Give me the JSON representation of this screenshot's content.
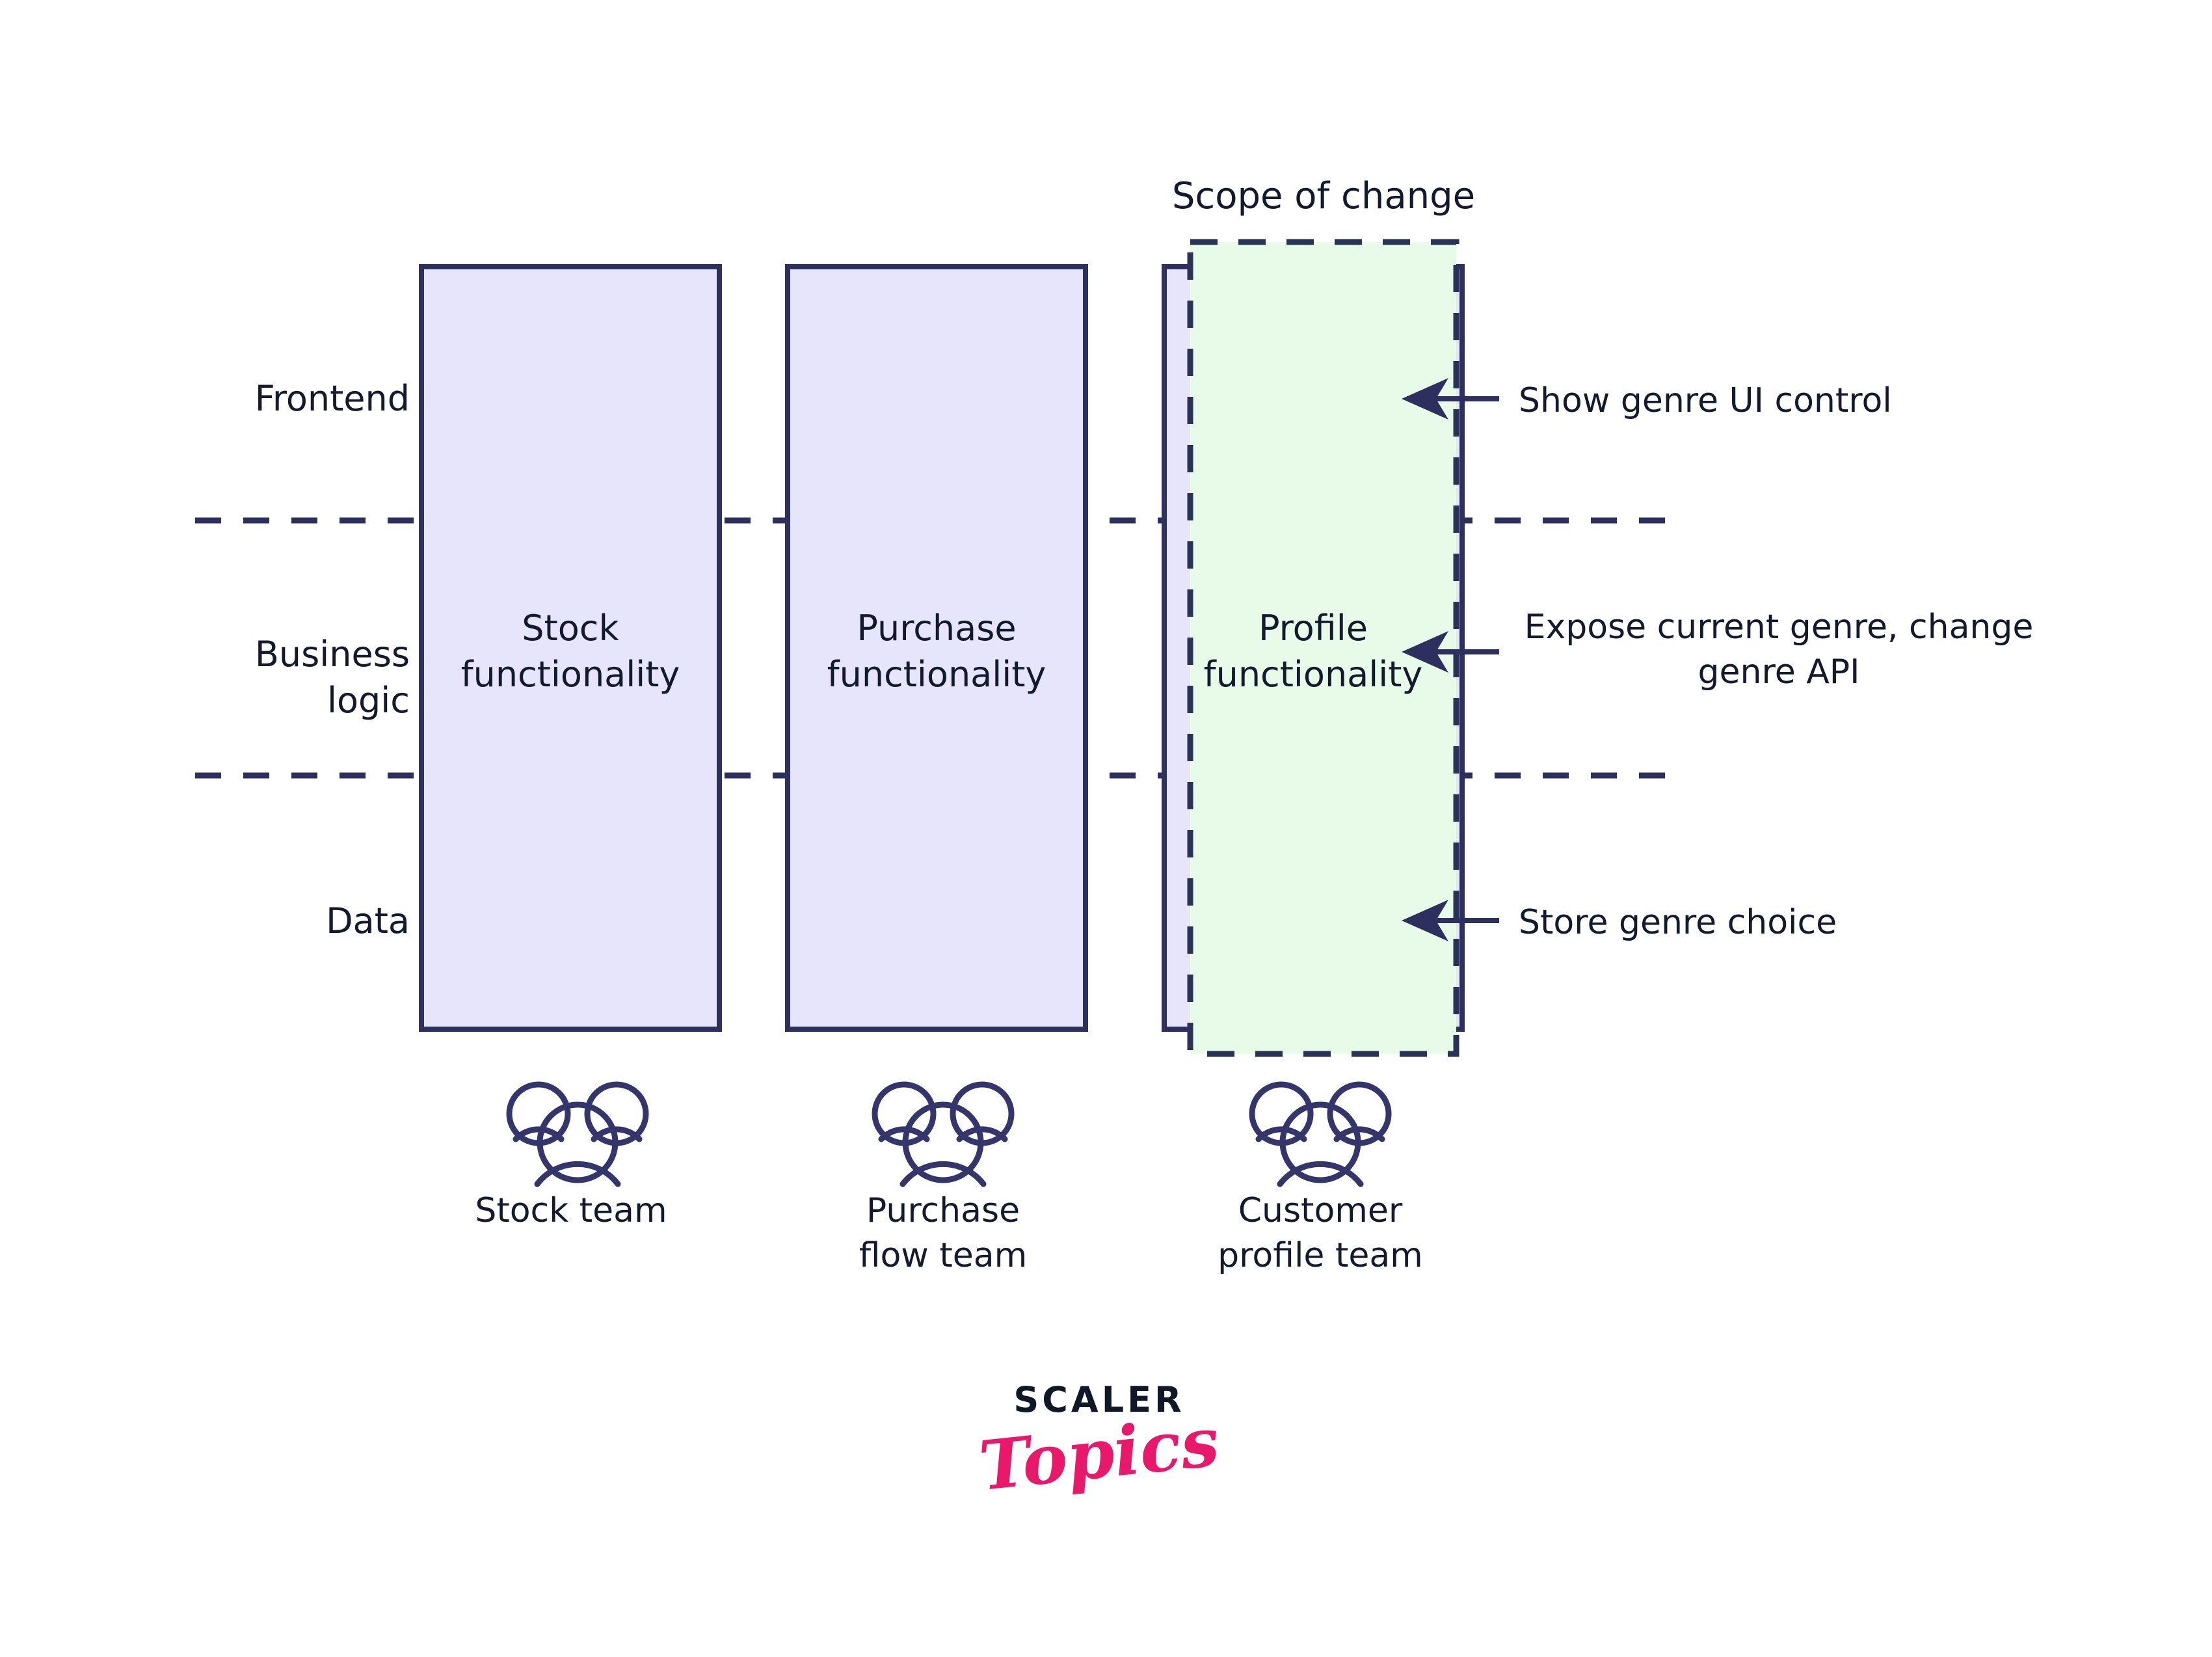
{
  "title": "Scope of change",
  "colors": {
    "stroke": "#2d2f5e",
    "text": "#141a2e",
    "box_fill": "#e6e5fb",
    "scope_fill": "#e8fbe9",
    "scope_stroke": "#2a3356",
    "logo_pink": "#e8186b",
    "logo_dark": "#101828",
    "background": "#ffffff"
  },
  "layer_labels": [
    {
      "id": "frontend",
      "text": "Frontend"
    },
    {
      "id": "business-logic",
      "text": "Business\nlogic"
    },
    {
      "id": "data",
      "text": "Data"
    }
  ],
  "columns": [
    {
      "id": "stock",
      "box_label": "Stock\nfunctionality",
      "team_label": "Stock team",
      "team_icon": "people-group-icon",
      "highlighted": false
    },
    {
      "id": "purchase",
      "box_label": "Purchase\nfunctionality",
      "team_label": "Purchase\nflow team",
      "team_icon": "people-group-icon",
      "highlighted": false
    },
    {
      "id": "profile",
      "box_label": "Profile\nfunctionality",
      "team_label": "Customer\nprofile team",
      "team_icon": "people-group-icon",
      "highlighted": true
    }
  ],
  "callouts": [
    {
      "id": "frontend-callout",
      "text": "Show genre UI control",
      "layer": "Frontend"
    },
    {
      "id": "business-callout",
      "text": "Expose current genre, change\ngenre API",
      "layer": "Business logic"
    },
    {
      "id": "data-callout",
      "text": "Store genre choice",
      "layer": "Data"
    }
  ],
  "logo": {
    "primary": "SCALER",
    "secondary": "Topics"
  }
}
